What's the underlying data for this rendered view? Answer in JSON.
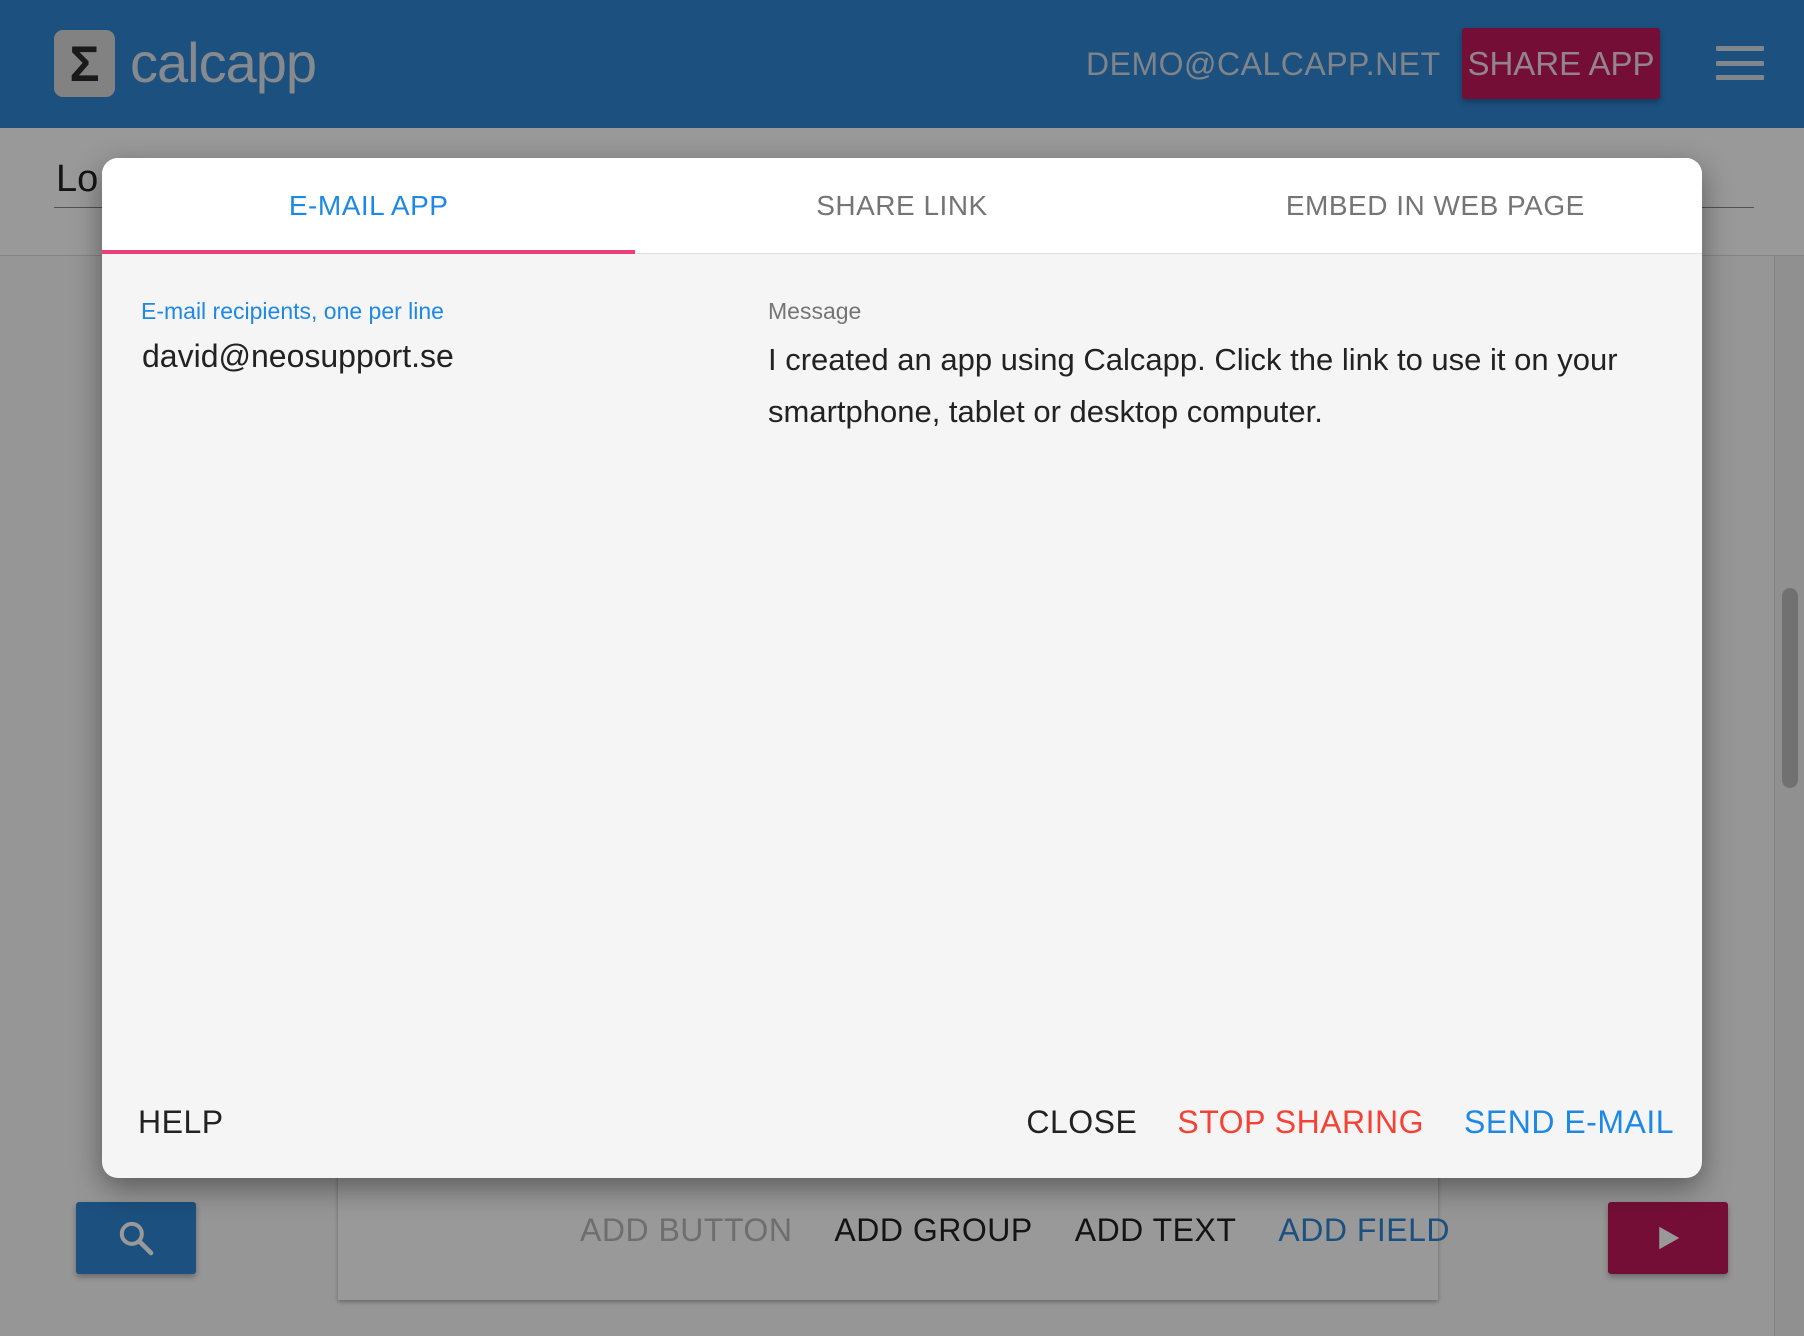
{
  "header": {
    "logo_symbol": "Σ",
    "app_name": "calcapp",
    "user_email": "DEMO@CALCAPP.NET",
    "share_label": "SHARE APP",
    "menu_icon": "hamburger-menu-icon",
    "color": "#2f86d3",
    "accent": "#c2185b"
  },
  "background": {
    "title_fragment": "Lo",
    "actions": {
      "add_button": "ADD BUTTON",
      "add_group": "ADD GROUP",
      "add_text": "ADD TEXT",
      "add_field": "ADD FIELD"
    },
    "search_icon": "search-icon",
    "play_icon": "play-icon"
  },
  "dialog": {
    "tabs": [
      {
        "label": "E-MAIL APP",
        "active": true
      },
      {
        "label": "SHARE LINK",
        "active": false
      },
      {
        "label": "EMBED IN WEB PAGE",
        "active": false
      }
    ],
    "recipients_label": "E-mail recipients, one per line",
    "recipients_value": "david@neosupport.se",
    "message_label": "Message",
    "message_value": "I created an app using Calcapp. Click the link to use it on your smartphone, tablet or desktop computer.",
    "help_label": "HELP",
    "close_label": "CLOSE",
    "stop_label": "STOP SHARING",
    "send_label": "SEND E-MAIL",
    "colors": {
      "active_tab": "#1e88e5",
      "tab_indicator": "#ec407a",
      "stop": "#f44336",
      "send": "#1e88e5"
    }
  }
}
